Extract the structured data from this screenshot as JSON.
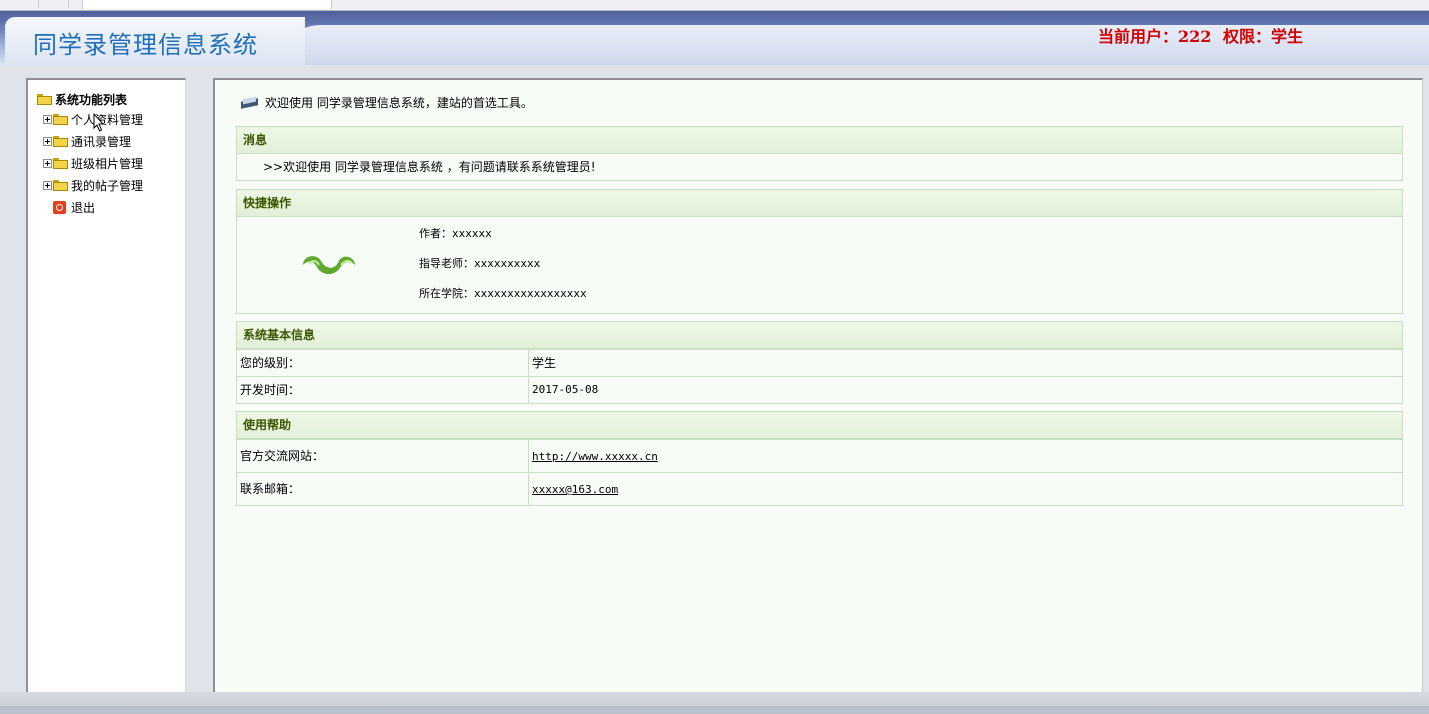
{
  "app": {
    "title": "同学录管理信息系统"
  },
  "user": {
    "current_user": "当前用户：222",
    "permission": "权限：学生"
  },
  "sidebar": {
    "root_label": "系统功能列表",
    "items": [
      {
        "label": "个人资料管理"
      },
      {
        "label": "通讯录管理"
      },
      {
        "label": "班级相片管理"
      },
      {
        "label": "我的帖子管理"
      },
      {
        "label": "退出"
      }
    ]
  },
  "welcome": {
    "text": "欢迎使用 同学录管理信息系统，建站的首选工具。"
  },
  "message": {
    "title": "消息",
    "text": ">>欢迎使用 同学录管理信息系统 ，有问题请联系系统管理员!"
  },
  "quick": {
    "title": "快捷操作",
    "author": "作者：xxxxxx",
    "teacher": "指导老师：xxxxxxxxxx",
    "college": "所在学院：xxxxxxxxxxxxxxxxx"
  },
  "sysinfo": {
    "title": "系统基本信息",
    "rows": [
      {
        "key": "您的级别：",
        "value": "学生"
      },
      {
        "key": "开发时间：",
        "value": "2017-05-08"
      }
    ]
  },
  "help": {
    "title": "使用帮助",
    "rows": [
      {
        "key": "官方交流网站：",
        "value": "http://www.xxxxx.cn"
      },
      {
        "key": "联系邮箱：",
        "value": "xxxxx@163.com"
      }
    ]
  },
  "colors": {
    "title_blue": "#1f6fb8",
    "user_red": "#d40000",
    "section_head_text": "#3b5700",
    "section_border": "#c9dfc3"
  }
}
